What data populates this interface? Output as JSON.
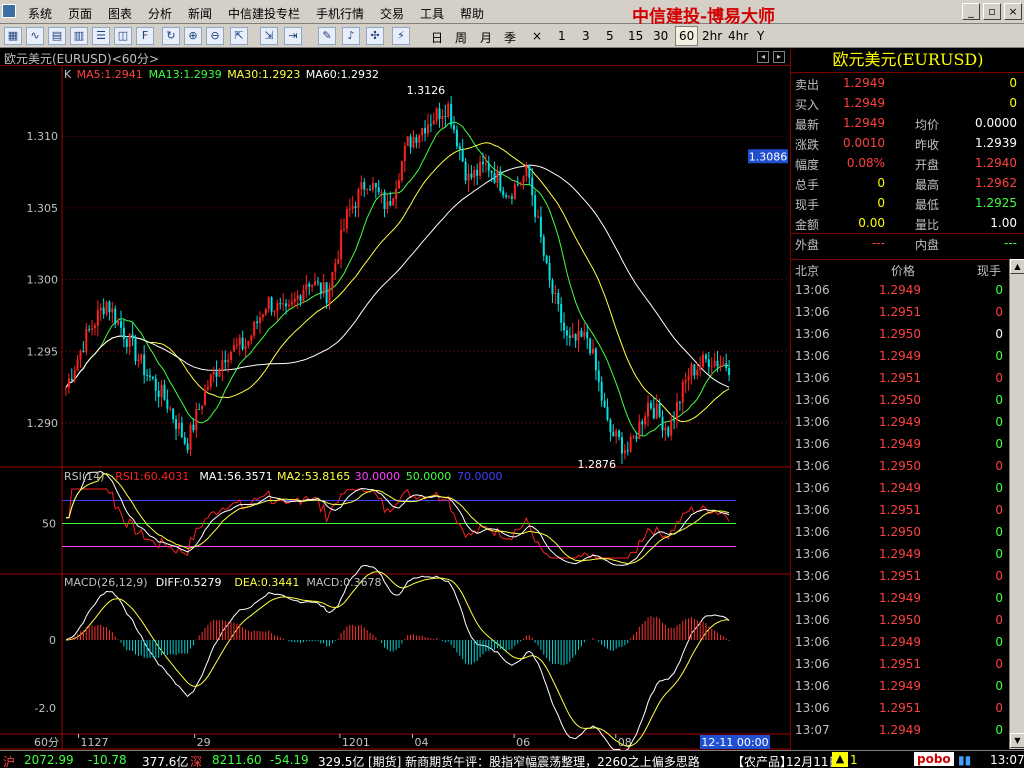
{
  "menu": {
    "items": [
      "系统",
      "页面",
      "图表",
      "分析",
      "新闻",
      "中信建投专栏",
      "手机行情",
      "交易",
      "工具",
      "帮助"
    ],
    "brand": "中信建投-博易大师"
  },
  "toolbar": {
    "periods": [
      "日",
      "周",
      "月",
      "季",
      "×",
      "1",
      "3",
      "5",
      "15",
      "30",
      "60",
      "2hr",
      "4hr",
      "Y"
    ],
    "active_period": "60"
  },
  "chart": {
    "title": "欧元美元(EURUSD)<60分>",
    "ma_legend": [
      {
        "text": "K",
        "color": "#c0c0c0"
      },
      {
        "text": "MA5:1.2941",
        "color": "#ff4040"
      },
      {
        "text": "MA13:1.2939",
        "color": "#40ff40"
      },
      {
        "text": "MA30:1.2923",
        "color": "#ffff40"
      },
      {
        "text": "MA60:1.2932",
        "color": "#ffffff"
      }
    ],
    "rsi_legend": [
      {
        "text": "RSI(14)",
        "color": "#c0c0c0"
      },
      {
        "text": "RSI1:60.4031",
        "color": "#ff2020"
      },
      {
        "text": "MA1:56.3571",
        "color": "#ffffff"
      },
      {
        "text": "MA2:53.8165",
        "color": "#ffff40"
      },
      {
        "text": "30.0000",
        "color": "#ff40ff"
      },
      {
        "text": "50.0000",
        "color": "#40ff40"
      },
      {
        "text": "70.0000",
        "color": "#4040ff"
      }
    ],
    "macd_legend": [
      {
        "text": "MACD(26,12,9)",
        "color": "#c0c0c0"
      },
      {
        "text": "DIFF:0.5279",
        "color": "#ffffff"
      },
      {
        "text": "DEA:0.3441",
        "color": "#ffff40"
      },
      {
        "text": "MACD:0.3678",
        "color": "#c0c0c0"
      }
    ],
    "high_label": "1.3126",
    "low_label": "1.2876",
    "current_price_tag": "1.3086",
    "rsi_tick": "50",
    "macd_ticks": [
      "0",
      "-2.0"
    ],
    "period_label": "60分",
    "date_labels": [
      "1127",
      "29",
      "1201",
      "04",
      "06",
      "08"
    ],
    "cursor_date": "12-11 00:00"
  },
  "chart_data": {
    "type": "candlestick",
    "title": "欧元美元(EURUSD)<60分>",
    "ylim": [
      1.287,
      1.3135
    ],
    "y_ticks": [
      1.29,
      1.295,
      1.3,
      1.305,
      1.31
    ],
    "x_date_labels": [
      "1127",
      "29",
      "1201",
      "04",
      "06",
      "08"
    ],
    "price_anchors": [
      1.2925,
      1.296,
      1.2985,
      1.296,
      1.2935,
      1.2915,
      1.2885,
      1.2925,
      1.295,
      1.2955,
      1.2985,
      1.2975,
      1.3,
      1.299,
      1.3045,
      1.307,
      1.305,
      1.3095,
      1.311,
      1.3122,
      1.307,
      1.308,
      1.306,
      1.3075,
      1.3,
      1.2955,
      1.296,
      1.2895,
      1.288,
      1.2915,
      1.2895,
      1.2935,
      1.2945,
      1.294
    ],
    "high": 1.3126,
    "low": 1.2876,
    "last": 1.2949,
    "indicators": {
      "MA5": 1.2941,
      "MA13": 1.2939,
      "MA30": 1.2923,
      "MA60": 1.2932,
      "RSI1": 60.4031,
      "RSI_MA1": 56.3571,
      "RSI_MA2": 53.8165,
      "RSI_levels": [
        30,
        50,
        70
      ],
      "DIFF": 0.5279,
      "DEA": 0.3441,
      "MACD": 0.3678
    }
  },
  "quote": {
    "title": "欧元美元(EURUSD)",
    "rows": [
      {
        "l1": "卖出",
        "v1": "1.2949",
        "c1": "#ff4040",
        "l2": "",
        "v2": "0",
        "c2": "#ffff00"
      },
      {
        "l1": "买入",
        "v1": "1.2949",
        "c1": "#ff4040",
        "l2": "",
        "v2": "0",
        "c2": "#ffff00"
      },
      {
        "l1": "最新",
        "v1": "1.2949",
        "c1": "#ff4040",
        "l2": "均价",
        "v2": "0.0000",
        "c2": "#ffffff"
      },
      {
        "l1": "涨跌",
        "v1": "0.0010",
        "c1": "#ff4040",
        "l2": "昨收",
        "v2": "1.2939",
        "c2": "#ffffff"
      },
      {
        "l1": "幅度",
        "v1": "0.08%",
        "c1": "#ff4040",
        "l2": "开盘",
        "v2": "1.2940",
        "c2": "#ff4040"
      },
      {
        "l1": "总手",
        "v1": "0",
        "c1": "#ffff00",
        "l2": "最高",
        "v2": "1.2962",
        "c2": "#ff4040"
      },
      {
        "l1": "现手",
        "v1": "0",
        "c1": "#ffff00",
        "l2": "最低",
        "v2": "1.2925",
        "c2": "#40ff40"
      },
      {
        "l1": "金额",
        "v1": "0.00",
        "c1": "#ffff00",
        "l2": "量比",
        "v2": "1.00",
        "c2": "#ffffff"
      },
      {
        "l1": "外盘",
        "v1": "---",
        "c1": "#ff4040",
        "l2": "内盘",
        "v2": "---",
        "c2": "#40ff40"
      }
    ],
    "tick_headers": [
      "北京",
      "价格",
      "现手"
    ],
    "ticks": [
      {
        "t": "13:06",
        "p": "1.2949",
        "v": "0",
        "c": "#40ff40"
      },
      {
        "t": "13:06",
        "p": "1.2951",
        "v": "0",
        "c": "#ff4040"
      },
      {
        "t": "13:06",
        "p": "1.2950",
        "v": "0",
        "c": "#ffffff"
      },
      {
        "t": "13:06",
        "p": "1.2949",
        "v": "0",
        "c": "#40ff40"
      },
      {
        "t": "13:06",
        "p": "1.2951",
        "v": "0",
        "c": "#ff4040"
      },
      {
        "t": "13:06",
        "p": "1.2950",
        "v": "0",
        "c": "#40ff40"
      },
      {
        "t": "13:06",
        "p": "1.2949",
        "v": "0",
        "c": "#40ff40"
      },
      {
        "t": "13:06",
        "p": "1.2949",
        "v": "0",
        "c": "#40ff40"
      },
      {
        "t": "13:06",
        "p": "1.2950",
        "v": "0",
        "c": "#ff4040"
      },
      {
        "t": "13:06",
        "p": "1.2949",
        "v": "0",
        "c": "#40ff40"
      },
      {
        "t": "13:06",
        "p": "1.2951",
        "v": "0",
        "c": "#ff4040"
      },
      {
        "t": "13:06",
        "p": "1.2950",
        "v": "0",
        "c": "#40ff40"
      },
      {
        "t": "13:06",
        "p": "1.2949",
        "v": "0",
        "c": "#40ff40"
      },
      {
        "t": "13:06",
        "p": "1.2951",
        "v": "0",
        "c": "#ff4040"
      },
      {
        "t": "13:06",
        "p": "1.2949",
        "v": "0",
        "c": "#40ff40"
      },
      {
        "t": "13:06",
        "p": "1.2950",
        "v": "0",
        "c": "#ff4040"
      },
      {
        "t": "13:06",
        "p": "1.2949",
        "v": "0",
        "c": "#40ff40"
      },
      {
        "t": "13:06",
        "p": "1.2951",
        "v": "0",
        "c": "#ff4040"
      },
      {
        "t": "13:06",
        "p": "1.2949",
        "v": "0",
        "c": "#40ff40"
      },
      {
        "t": "13:06",
        "p": "1.2951",
        "v": "0",
        "c": "#ff4040"
      },
      {
        "t": "13:07",
        "p": "1.2949",
        "v": "0",
        "c": "#40ff40"
      }
    ]
  },
  "status": {
    "sh_label": "沪",
    "sh_index": "2072.99",
    "sh_change": "-10.78",
    "sh_amount": "377.6亿",
    "sz_label": "深",
    "sz_index": "8211.60",
    "sz_change": "-54.19",
    "sz_amount": "329.5亿",
    "news": "[期货] 新商期货午评：股指窄幅震荡整理，2260之上偏多思路",
    "product": "【农产品】",
    "date": "12月11日",
    "alert": "1",
    "brand": "pobo",
    "time": "13:07"
  },
  "colors": {
    "up": "#ff2020",
    "down": "#00e0e0",
    "grid": "#a00000",
    "ma5": "#ffffff",
    "ma13": "#40ff40",
    "ma30": "#ffff40",
    "ma60": "#ffffff"
  }
}
